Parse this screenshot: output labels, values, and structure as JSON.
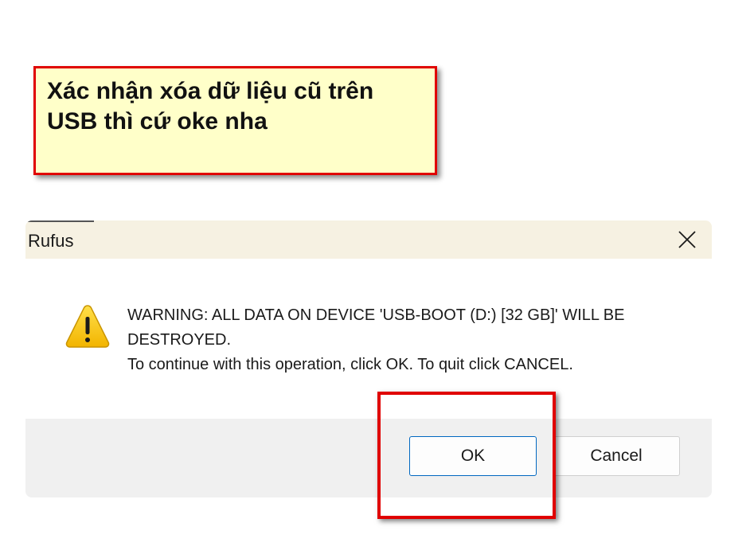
{
  "annotation": {
    "text": "Xác nhận xóa dữ liệu cũ trên\nUSB thì cứ oke nha"
  },
  "dialog": {
    "title": "Rufus",
    "icon": "warning-icon",
    "message_lines": [
      "WARNING: ALL DATA ON DEVICE 'USB-BOOT (D:) [32 GB]' WILL BE",
      "DESTROYED.",
      "To continue with this operation, click OK. To quit click CANCEL."
    ],
    "buttons": {
      "ok_label": "OK",
      "cancel_label": "Cancel"
    }
  },
  "colors": {
    "annotation_border": "#e00000",
    "annotation_fill": "#ffffc9",
    "titlebar": "#f6f1e2",
    "footer": "#f0f0f0",
    "ok_border": "#0067c0",
    "warning_yellow": "#f8c800"
  }
}
